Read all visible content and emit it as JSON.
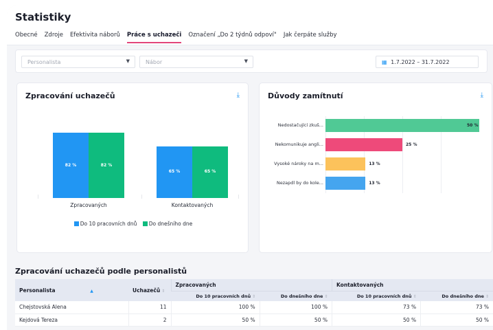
{
  "page": {
    "title": "Statistiky",
    "tabs": [
      {
        "label": "Obecné"
      },
      {
        "label": "Zdroje"
      },
      {
        "label": "Efektivita náborů"
      },
      {
        "label": "Práce s uchazeči",
        "active": true
      },
      {
        "label": "Označení „Do 2 týdnů odpoví\""
      },
      {
        "label": "Jak čerpáte služby"
      }
    ]
  },
  "filters": {
    "personalista_placeholder": "Personalista",
    "nabor_placeholder": "Nábor",
    "date_range": "1.7.2022 – 31.7.2022"
  },
  "processing_card": {
    "title": "Zpracování uchazečů"
  },
  "reasons_card": {
    "title": "Důvody zamítnutí"
  },
  "chart_data": [
    {
      "type": "bar",
      "title": "Zpracování uchazečů",
      "categories": [
        "Zpracovaných",
        "Kontaktovaných"
      ],
      "series": [
        {
          "name": "Do 10 pracovních dnů",
          "values": [
            82,
            65
          ],
          "labels": [
            "82 %",
            "65 %"
          ],
          "color": "#2196f3"
        },
        {
          "name": "Do dnešního dne",
          "values": [
            82,
            65
          ],
          "labels": [
            "82 %",
            "65 %"
          ],
          "color": "#0fbb7e"
        }
      ],
      "ylim": [
        0,
        100
      ],
      "legend": "bottom"
    },
    {
      "type": "bar",
      "orientation": "horizontal",
      "title": "Důvody zamítnutí",
      "categories": [
        "Nedostačující zkuš...",
        "Nekomunikuje angli...",
        "Vysoké nároky na m...",
        "Nezapdl by do kole..."
      ],
      "values": [
        50,
        25,
        13,
        13
      ],
      "labels": [
        "50 %",
        "25 %",
        "13 %",
        "13 %"
      ],
      "colors": [
        "#50c995",
        "#ee4a7a",
        "#fcc25b",
        "#45a5ef"
      ],
      "xlim": [
        0,
        50
      ]
    }
  ],
  "table": {
    "section_title": "Zpracování uchazečů podle personalistů",
    "headers": {
      "personalista": "Personalista",
      "uchazecu": "Uchazečů",
      "group1": "Zpracovaných",
      "group2": "Kontaktovaných",
      "sub_10": "Do 10 pracovních dnů",
      "sub_today": "Do dnešního dne"
    },
    "rows": [
      {
        "name": "Chejstovská Alena",
        "count": "11",
        "z10": "100 %",
        "zToday": "100 %",
        "k10": "73 %",
        "kToday": "73 %"
      },
      {
        "name": "Kejdová Tereza",
        "count": "2",
        "z10": "50 %",
        "zToday": "50 %",
        "k10": "50 %",
        "kToday": "50 %"
      }
    ]
  }
}
